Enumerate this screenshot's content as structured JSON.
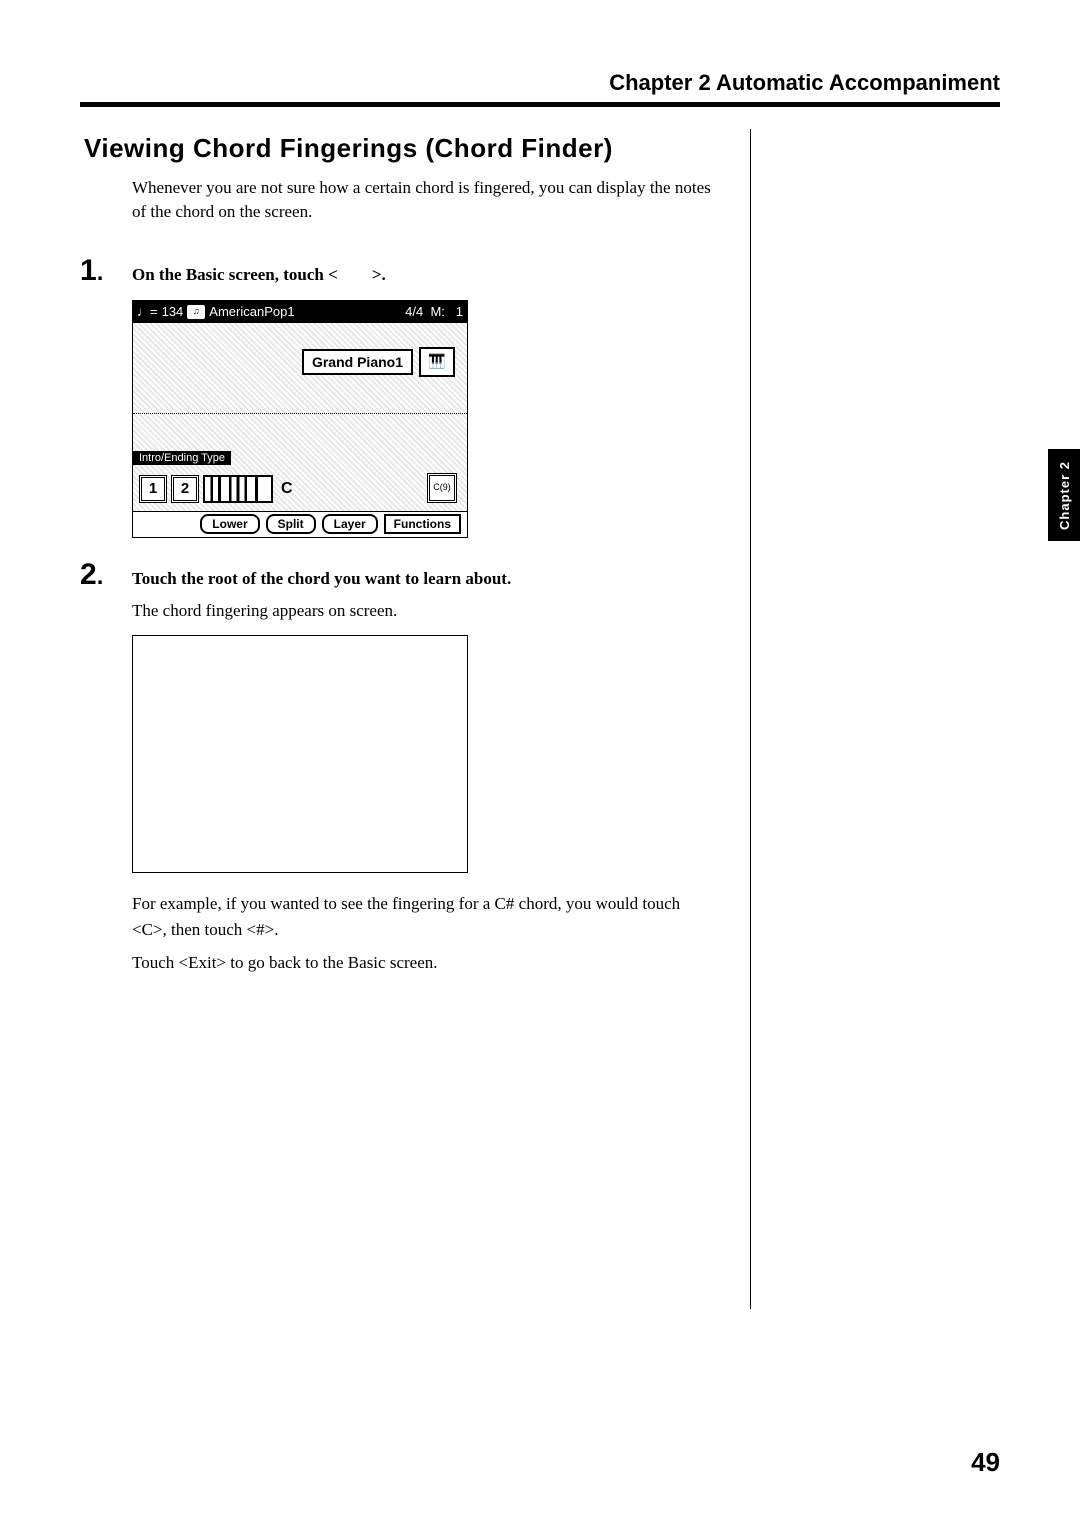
{
  "chapterHeader": "Chapter 2  Automatic Accompaniment",
  "sectionTitle": "Viewing Chord Fingerings (Chord Finder)",
  "intro": "Whenever you are not sure how a certain chord is fingered, you can display the notes of the chord on the screen.",
  "steps": {
    "s1": {
      "num": "1",
      "dot": ".",
      "head_a": "On the Basic screen, touch <",
      "head_b": ">."
    },
    "s2": {
      "num": "2",
      "dot": ".",
      "head": "Touch the root of the chord you want to learn about.",
      "body1": "The chord fingering appears on screen.",
      "body2": "For example, if you wanted to see the fingering for a C# chord, you would touch <C>, then touch <#>.",
      "body3": "Touch <Exit> to go back to the Basic screen."
    }
  },
  "screen": {
    "tempoPrefix": "♩=",
    "tempo": "134",
    "styleName": "AmericanPop1",
    "timesig": "4/4",
    "measLabel": "M:",
    "meas": "1",
    "tone": "Grand Piano1",
    "pianoGlyph": "🎹",
    "introLabel": "Intro/Ending Type",
    "type1": "1",
    "type2": "2",
    "chordLetter": "C",
    "lookup": "C(9)",
    "bottom": {
      "lower": "Lower",
      "split": "Split",
      "layer": "Layer",
      "functions": "Functions"
    }
  },
  "sideTab": "Chapter 2",
  "pageNumber": "49"
}
